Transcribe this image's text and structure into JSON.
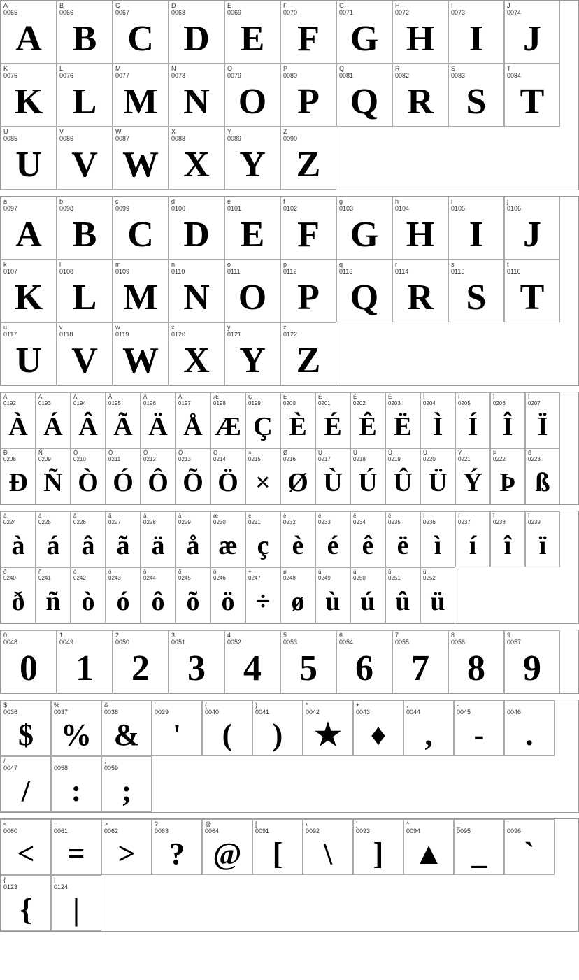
{
  "sections": [
    {
      "id": "uppercase",
      "cells": [
        {
          "label": "A",
          "code": "0065",
          "char": "A"
        },
        {
          "label": "B",
          "code": "0066",
          "char": "B"
        },
        {
          "label": "C",
          "code": "0067",
          "char": "C"
        },
        {
          "label": "D",
          "code": "0068",
          "char": "D"
        },
        {
          "label": "E",
          "code": "0069",
          "char": "E"
        },
        {
          "label": "F",
          "code": "0070",
          "char": "F"
        },
        {
          "label": "G",
          "code": "0071",
          "char": "G"
        },
        {
          "label": "H",
          "code": "0072",
          "char": "H"
        },
        {
          "label": "I",
          "code": "0073",
          "char": "I"
        },
        {
          "label": "J",
          "code": "0074",
          "char": "J"
        },
        {
          "label": "K",
          "code": "0075",
          "char": "K"
        },
        {
          "label": "L",
          "code": "0076",
          "char": "L"
        },
        {
          "label": "M",
          "code": "0077",
          "char": "M"
        },
        {
          "label": "N",
          "code": "0078",
          "char": "N"
        },
        {
          "label": "O",
          "code": "0079",
          "char": "O"
        },
        {
          "label": "P",
          "code": "0080",
          "char": "P"
        },
        {
          "label": "Q",
          "code": "0081",
          "char": "Q"
        },
        {
          "label": "R",
          "code": "0082",
          "char": "R"
        },
        {
          "label": "S",
          "code": "0083",
          "char": "S"
        },
        {
          "label": "T",
          "code": "0084",
          "char": "T"
        },
        {
          "label": "U",
          "code": "0085",
          "char": "U"
        },
        {
          "label": "V",
          "code": "0086",
          "char": "V"
        },
        {
          "label": "W",
          "code": "0087",
          "char": "W"
        },
        {
          "label": "X",
          "code": "0088",
          "char": "X"
        },
        {
          "label": "Y",
          "code": "0089",
          "char": "Y"
        },
        {
          "label": "Z",
          "code": "0090",
          "char": "Z"
        }
      ]
    },
    {
      "id": "lowercase",
      "cells": [
        {
          "label": "a",
          "code": "0097",
          "char": "A"
        },
        {
          "label": "b",
          "code": "0098",
          "char": "B"
        },
        {
          "label": "c",
          "code": "0099",
          "char": "C"
        },
        {
          "label": "d",
          "code": "0100",
          "char": "D"
        },
        {
          "label": "e",
          "code": "0101",
          "char": "E"
        },
        {
          "label": "f",
          "code": "0102",
          "char": "F"
        },
        {
          "label": "g",
          "code": "0103",
          "char": "G"
        },
        {
          "label": "h",
          "code": "0104",
          "char": "H"
        },
        {
          "label": "i",
          "code": "0105",
          "char": "I"
        },
        {
          "label": "j",
          "code": "0106",
          "char": "J"
        },
        {
          "label": "k",
          "code": "0107",
          "char": "K"
        },
        {
          "label": "l",
          "code": "0108",
          "char": "L"
        },
        {
          "label": "m",
          "code": "0109",
          "char": "M"
        },
        {
          "label": "n",
          "code": "0110",
          "char": "N"
        },
        {
          "label": "o",
          "code": "0111",
          "char": "O"
        },
        {
          "label": "p",
          "code": "0112",
          "char": "P"
        },
        {
          "label": "q",
          "code": "0113",
          "char": "Q"
        },
        {
          "label": "r",
          "code": "0114",
          "char": "R"
        },
        {
          "label": "s",
          "code": "0115",
          "char": "S"
        },
        {
          "label": "t",
          "code": "0116",
          "char": "T"
        },
        {
          "label": "u",
          "code": "0117",
          "char": "U"
        },
        {
          "label": "v",
          "code": "0118",
          "char": "V"
        },
        {
          "label": "w",
          "code": "0119",
          "char": "W"
        },
        {
          "label": "x",
          "code": "0120",
          "char": "X"
        },
        {
          "label": "y",
          "code": "0121",
          "char": "Y"
        },
        {
          "label": "z",
          "code": "0122",
          "char": "Z"
        }
      ]
    },
    {
      "id": "accented1",
      "cells": [
        {
          "label": "À",
          "code": "0192",
          "char": "À"
        },
        {
          "label": "Á",
          "code": "0193",
          "char": "Á"
        },
        {
          "label": "Â",
          "code": "0194",
          "char": "Â"
        },
        {
          "label": "Ã",
          "code": "0195",
          "char": "Ã"
        },
        {
          "label": "Ä",
          "code": "0196",
          "char": "Ä"
        },
        {
          "label": "Å",
          "code": "0197",
          "char": "Å"
        },
        {
          "label": "Æ",
          "code": "0198",
          "char": "Æ"
        },
        {
          "label": "Ç",
          "code": "0199",
          "char": "Ç"
        },
        {
          "label": "È",
          "code": "0200",
          "char": "È"
        },
        {
          "label": "É",
          "code": "0201",
          "char": "É"
        },
        {
          "label": "Ê",
          "code": "0202",
          "char": "Ê"
        },
        {
          "label": "Ë",
          "code": "0203",
          "char": "Ë"
        },
        {
          "label": "Ì",
          "code": "0204",
          "char": "Ì"
        },
        {
          "label": "Í",
          "code": "0205",
          "char": "Í"
        },
        {
          "label": "Î",
          "code": "0206",
          "char": "Î"
        },
        {
          "label": "Ï",
          "code": "0207",
          "char": "Ï"
        },
        {
          "label": "Ð",
          "code": "0208",
          "char": "Ð"
        },
        {
          "label": "Ñ",
          "code": "0209",
          "char": "Ñ"
        },
        {
          "label": "Ò",
          "code": "0210",
          "char": "Ò"
        },
        {
          "label": "Ó",
          "code": "0211",
          "char": "Ó"
        },
        {
          "label": "Ô",
          "code": "0212",
          "char": "Ô"
        },
        {
          "label": "Õ",
          "code": "0213",
          "char": "Õ"
        },
        {
          "label": "Ö",
          "code": "0214",
          "char": "Ö"
        },
        {
          "label": "×",
          "code": "0215",
          "char": "×"
        },
        {
          "label": "Ø",
          "code": "0216",
          "char": "Ø"
        },
        {
          "label": "Ù",
          "code": "0217",
          "char": "Ù"
        },
        {
          "label": "Ú",
          "code": "0218",
          "char": "Ú"
        },
        {
          "label": "Û",
          "code": "0219",
          "char": "Û"
        },
        {
          "label": "Ü",
          "code": "0220",
          "char": "Ü"
        },
        {
          "label": "Ý",
          "code": "0221",
          "char": "Ý"
        },
        {
          "label": "Þ",
          "code": "0222",
          "char": "Þ"
        },
        {
          "label": "ß",
          "code": "0223",
          "char": "ß"
        }
      ]
    },
    {
      "id": "accented2",
      "cells": [
        {
          "label": "à",
          "code": "0224",
          "char": "à"
        },
        {
          "label": "á",
          "code": "0225",
          "char": "á"
        },
        {
          "label": "â",
          "code": "0226",
          "char": "â"
        },
        {
          "label": "ã",
          "code": "0227",
          "char": "ã"
        },
        {
          "label": "ä",
          "code": "0228",
          "char": "ä"
        },
        {
          "label": "å",
          "code": "0229",
          "char": "å"
        },
        {
          "label": "æ",
          "code": "0230",
          "char": "æ"
        },
        {
          "label": "ç",
          "code": "0231",
          "char": "ç"
        },
        {
          "label": "è",
          "code": "0232",
          "char": "è"
        },
        {
          "label": "é",
          "code": "0233",
          "char": "é"
        },
        {
          "label": "ê",
          "code": "0234",
          "char": "ê"
        },
        {
          "label": "ë",
          "code": "0235",
          "char": "ë"
        },
        {
          "label": "ì",
          "code": "0236",
          "char": "ì"
        },
        {
          "label": "í",
          "code": "0237",
          "char": "í"
        },
        {
          "label": "î",
          "code": "0238",
          "char": "î"
        },
        {
          "label": "ï",
          "code": "0239",
          "char": "ï"
        },
        {
          "label": "ð",
          "code": "0240",
          "char": "ð"
        },
        {
          "label": "ñ",
          "code": "0241",
          "char": "ñ"
        },
        {
          "label": "ò",
          "code": "0242",
          "char": "ò"
        },
        {
          "label": "ó",
          "code": "0243",
          "char": "ó"
        },
        {
          "label": "ô",
          "code": "0244",
          "char": "ô"
        },
        {
          "label": "õ",
          "code": "0245",
          "char": "õ"
        },
        {
          "label": "ö",
          "code": "0246",
          "char": "ö"
        },
        {
          "label": "÷",
          "code": "0247",
          "char": "÷"
        },
        {
          "label": "ø",
          "code": "0248",
          "char": "ø"
        },
        {
          "label": "ù",
          "code": "0249",
          "char": "ù"
        },
        {
          "label": "ú",
          "code": "0250",
          "char": "ú"
        },
        {
          "label": "û",
          "code": "0251",
          "char": "û"
        },
        {
          "label": "ü",
          "code": "0252",
          "char": "ü"
        }
      ]
    },
    {
      "id": "numbers",
      "cells": [
        {
          "label": "0",
          "code": "0048",
          "char": "0"
        },
        {
          "label": "1",
          "code": "0049",
          "char": "1"
        },
        {
          "label": "2",
          "code": "0050",
          "char": "2"
        },
        {
          "label": "3",
          "code": "0051",
          "char": "3"
        },
        {
          "label": "4",
          "code": "0052",
          "char": "4"
        },
        {
          "label": "5",
          "code": "0053",
          "char": "5"
        },
        {
          "label": "6",
          "code": "0054",
          "char": "6"
        },
        {
          "label": "7",
          "code": "0055",
          "char": "7"
        },
        {
          "label": "8",
          "code": "0056",
          "char": "8"
        },
        {
          "label": "9",
          "code": "0057",
          "char": "9"
        }
      ]
    },
    {
      "id": "symbols1",
      "cells": [
        {
          "label": "$",
          "code": "0036",
          "char": "$"
        },
        {
          "label": "%",
          "code": "0037",
          "char": "%"
        },
        {
          "label": "&",
          "code": "0038",
          "char": "&"
        },
        {
          "label": "'",
          "code": "0039",
          "char": "'"
        },
        {
          "label": "(",
          "code": "0040",
          "char": "("
        },
        {
          "label": ")",
          "code": "0041",
          "char": ")"
        },
        {
          "label": "*",
          "code": "0042",
          "char": "★"
        },
        {
          "label": "+",
          "code": "0043",
          "char": "♦"
        },
        {
          "label": ",",
          "code": "0044",
          "char": ","
        },
        {
          "label": "-",
          "code": "0045",
          "char": "-"
        },
        {
          "label": ".",
          "code": "0046",
          "char": "."
        },
        {
          "label": "/",
          "code": "0047",
          "char": "/"
        },
        {
          "label": ":",
          "code": "0058",
          "char": ":"
        },
        {
          "label": ";",
          "code": "0059",
          "char": ";"
        }
      ]
    },
    {
      "id": "symbols2",
      "cells": [
        {
          "label": "<",
          "code": "0060",
          "char": "<"
        },
        {
          "label": "=",
          "code": "0061",
          "char": "="
        },
        {
          "label": ">",
          "code": "0062",
          "char": ">"
        },
        {
          "label": "?",
          "code": "0063",
          "char": "?"
        },
        {
          "label": "@",
          "code": "0064",
          "char": "@"
        },
        {
          "label": "[",
          "code": "0091",
          "char": "["
        },
        {
          "label": "\\",
          "code": "0092",
          "char": "\\"
        },
        {
          "label": "]",
          "code": "0093",
          "char": "]"
        },
        {
          "label": "^",
          "code": "0094",
          "char": "▲"
        },
        {
          "label": "_",
          "code": "0095",
          "char": "_"
        },
        {
          "label": "`",
          "code": "0096",
          "char": "`"
        },
        {
          "label": "{",
          "code": "0123",
          "char": "{"
        },
        {
          "label": "|",
          "code": "0124",
          "char": "|"
        }
      ]
    }
  ]
}
